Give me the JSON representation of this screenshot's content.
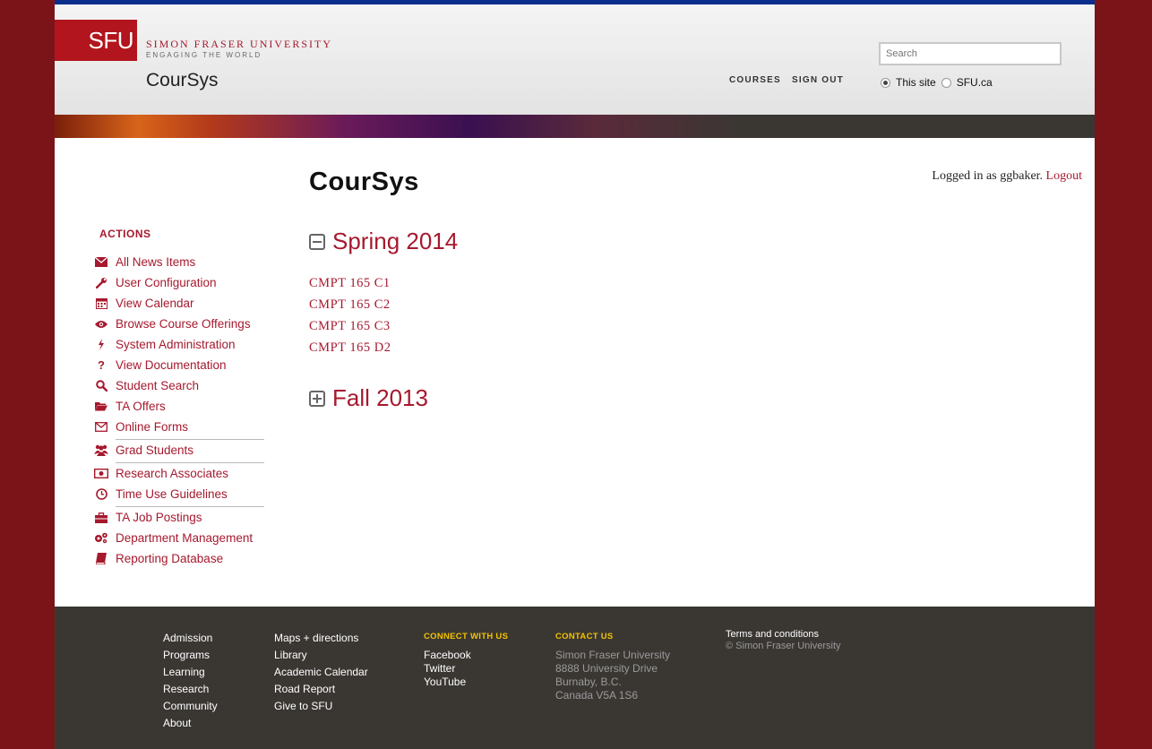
{
  "header": {
    "logo_text": "SFU",
    "university": "SIMON FRASER UNIVERSITY",
    "tagline": "ENGAGING THE WORLD",
    "site_title": "CourSys",
    "nav": [
      "COURSES",
      "SIGN OUT"
    ],
    "search_placeholder": "Search",
    "scope_options": [
      {
        "label": "This site",
        "selected": true
      },
      {
        "label": "SFU.ca",
        "selected": false
      }
    ]
  },
  "user": {
    "logged_in_prefix": "Logged in as ggbaker.",
    "logout_label": "Logout"
  },
  "main": {
    "title": "CourSys",
    "terms": [
      {
        "name": "Spring 2014",
        "expanded": true,
        "courses": [
          "CMPT 165 C1",
          "CMPT 165 C2",
          "CMPT 165 C3",
          "CMPT 165 D2"
        ]
      },
      {
        "name": "Fall 2013",
        "expanded": false,
        "courses": []
      }
    ]
  },
  "sidebar": {
    "heading": "ACTIONS",
    "items": [
      {
        "label": "All News Items",
        "icon": "envelope-icon"
      },
      {
        "label": "User Configuration",
        "icon": "wrench-icon"
      },
      {
        "label": "View Calendar",
        "icon": "calendar-icon"
      },
      {
        "label": "Browse Course Offerings",
        "icon": "eye-icon"
      },
      {
        "label": "System Administration",
        "icon": "bolt-icon"
      },
      {
        "label": "View Documentation",
        "icon": "question-icon"
      },
      {
        "label": "Student Search",
        "icon": "search-icon"
      },
      {
        "label": "TA Offers",
        "icon": "folder-icon"
      },
      {
        "label": "Online Forms",
        "icon": "envelope-outline-icon"
      },
      {
        "label": "Grad Students",
        "icon": "group-icon"
      },
      {
        "label": "Research Associates",
        "icon": "money-icon"
      },
      {
        "label": "Time Use Guidelines",
        "icon": "clock-icon"
      },
      {
        "label": "TA Job Postings",
        "icon": "briefcase-icon"
      },
      {
        "label": "Department Management",
        "icon": "gears-icon"
      },
      {
        "label": "Reporting Database",
        "icon": "book-icon"
      }
    ]
  },
  "footer": {
    "col1": [
      "Admission",
      "Programs",
      "Learning",
      "Research",
      "Community",
      "About"
    ],
    "col2": [
      "Maps + directions",
      "Library",
      "Academic Calendar",
      "Road Report",
      "Give to SFU"
    ],
    "connect_heading": "CONNECT WITH US",
    "connect": [
      "Facebook",
      "Twitter",
      "YouTube"
    ],
    "contact_heading": "CONTACT US",
    "contact": [
      "Simon Fraser University",
      "8888 University Drive",
      "Burnaby, B.C.",
      "Canada V5A 1S6"
    ],
    "terms": "Terms and conditions",
    "copyright": "© Simon Fraser University"
  },
  "colors": {
    "brand_red": "#a6192e",
    "page_background": "#7a1419",
    "footer_bg": "#3a3733",
    "footer_heading": "#f3c300"
  }
}
